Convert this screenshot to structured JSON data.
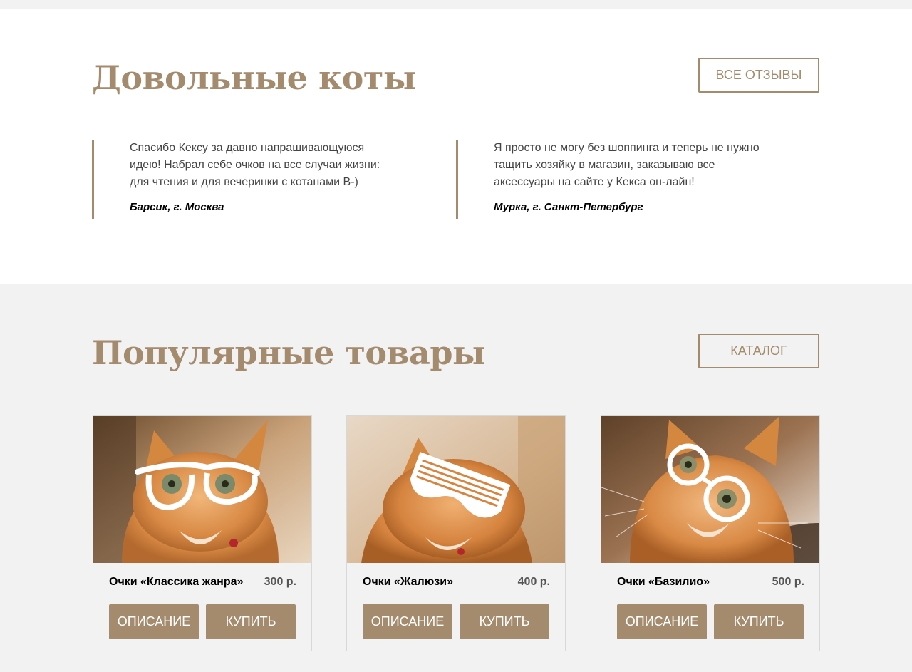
{
  "reviews": {
    "title": "Довольные коты",
    "all_button": "Все отзывы",
    "items": [
      {
        "text": "Спасибо Кексу за давно напрашивающуюся идею! Набрал себе очков на все случаи жизни: для чтения и для вечеринки с котанами В-)",
        "author": "Барсик, г. Москва"
      },
      {
        "text": "Я просто не могу без шоппинга и теперь не нужно тащить хозяйку в магазин, заказываю все аксессуары на сайте у Кекса он-лайн!",
        "author": "Мурка, г. Санкт-Петербург"
      }
    ]
  },
  "products": {
    "title": "Популярные товары",
    "catalog_button": "Каталог",
    "items": [
      {
        "name": "Очки «Классика жанра»",
        "price": "300 р.",
        "desc_label": "Описание",
        "buy_label": "Купить",
        "glasses": "classic-glasses"
      },
      {
        "name": "Очки «Жалюзи»",
        "price": "400 р.",
        "desc_label": "Описание",
        "buy_label": "Купить",
        "glasses": "shutter-glasses"
      },
      {
        "name": "Очки «Базилио»",
        "price": "500 р.",
        "desc_label": "Описание",
        "buy_label": "Купить",
        "glasses": "round-glasses"
      }
    ]
  },
  "colors": {
    "accent": "#a48b6d",
    "section_bg": "#f2f2f2",
    "white": "#ffffff"
  }
}
